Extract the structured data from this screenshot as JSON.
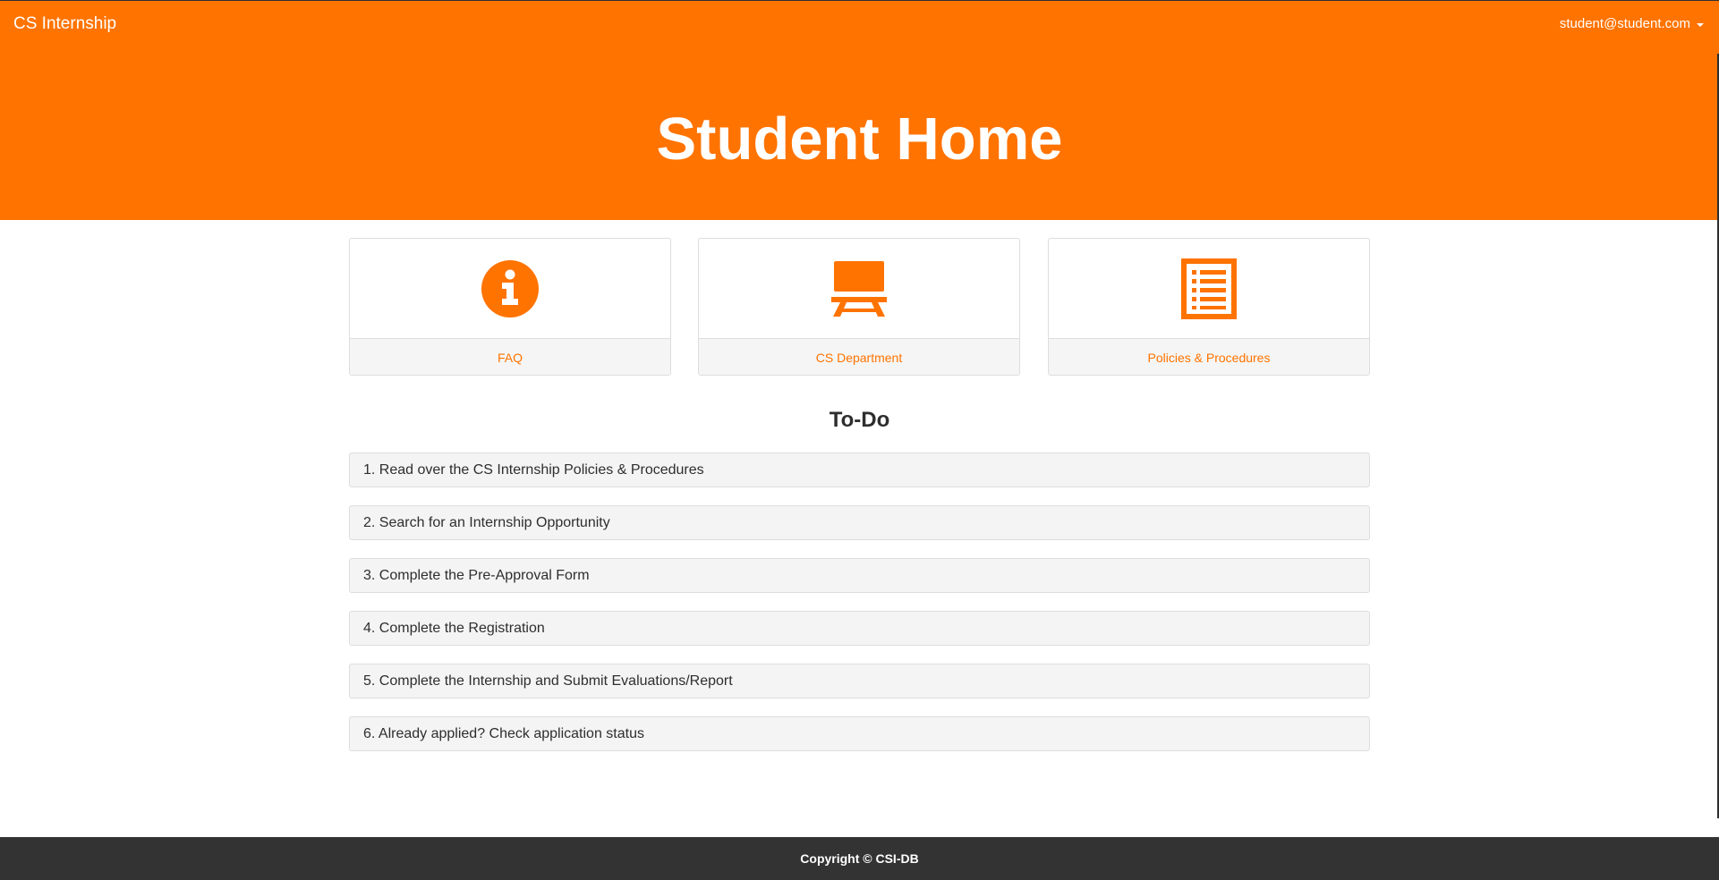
{
  "header": {
    "brand": "CS Internship",
    "user_email": "student@student.com",
    "title": "Student Home",
    "accent_color": "#ff7300"
  },
  "cards": [
    {
      "label": "FAQ",
      "icon": "info-circle-icon"
    },
    {
      "label": "CS Department",
      "icon": "easel-board-icon"
    },
    {
      "label": "Policies & Procedures",
      "icon": "document-list-icon"
    }
  ],
  "todo": {
    "title": "To-Do",
    "items": [
      "1. Read over the CS Internship Policies & Procedures",
      "2. Search for an Internship Opportunity",
      "3. Complete the Pre-Approval Form",
      "4. Complete the Registration",
      "5. Complete the Internship and Submit Evaluations/Report",
      "6. Already applied? Check application status"
    ]
  },
  "footer": {
    "copyright": "Copyright © CSI-DB"
  }
}
